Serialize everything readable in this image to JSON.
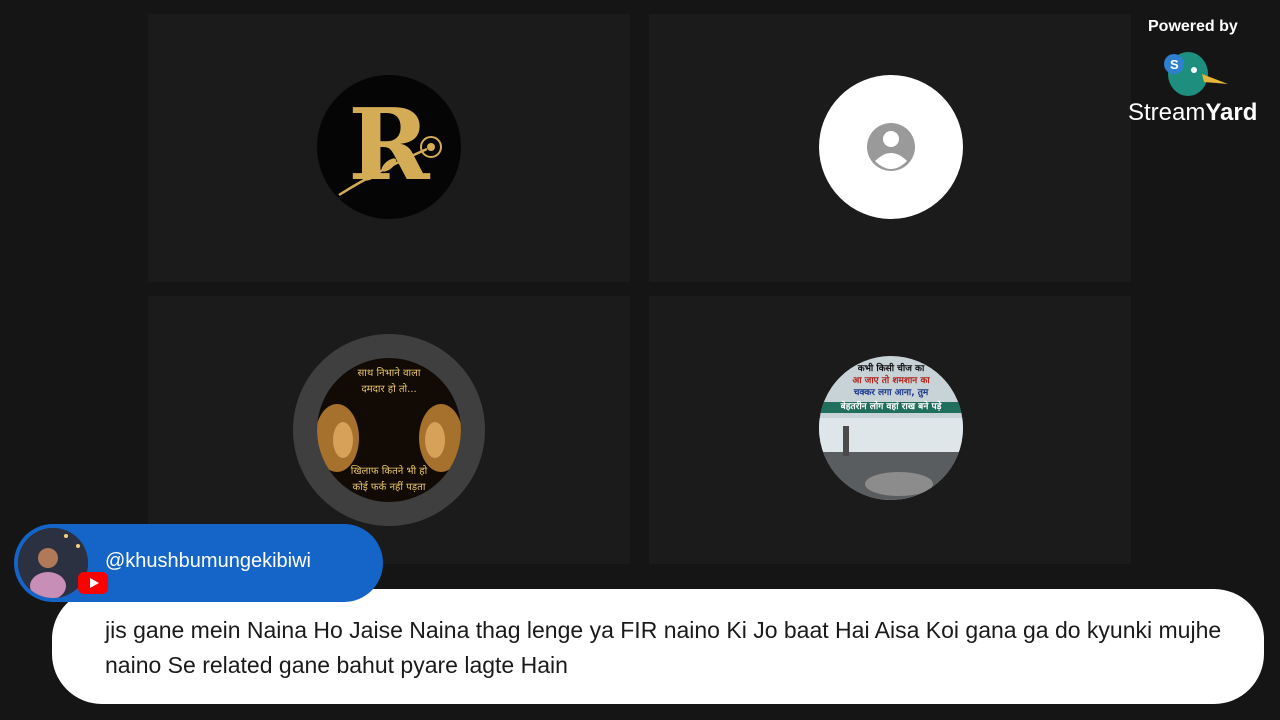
{
  "participants": [
    {
      "name": "participant-r",
      "letter": "R"
    },
    {
      "name": "participant-blank"
    },
    {
      "name": "participant-lions",
      "top_text_1": "साथ निभाने वाला",
      "top_text_2": "दमदार हो तो...",
      "bottom_text_1": "खिलाफ कितने भी हो",
      "bottom_text_2": "कोई फर्क नहीं पड़ता"
    },
    {
      "name": "participant-photo",
      "line_1": "कभी किसी चीज का",
      "line_2": "आ जाए तो शमशान का",
      "line_3": "चक्कर लगा आना, तुम",
      "line_4": "बेहतरीन लोग वहां राख बने पड़े"
    }
  ],
  "branding": {
    "powered_by": "Powered by",
    "name_light": "Stream",
    "name_bold": "Yard"
  },
  "comment": {
    "handle": "@khushbumungekibiwi",
    "platform_icon": "youtube-icon",
    "text": "jis gane mein Naina Ho Jaise Naina thag lenge ya FIR naino Ki Jo baat Hai Aisa Koi gana ga do kyunki mujhe naino Se related gane bahut pyare lagte Hain"
  },
  "colors": {
    "background": "#151515",
    "tile": "#1b1b1b",
    "name_pill": "#1565c8",
    "gold": "#d4ac55"
  }
}
